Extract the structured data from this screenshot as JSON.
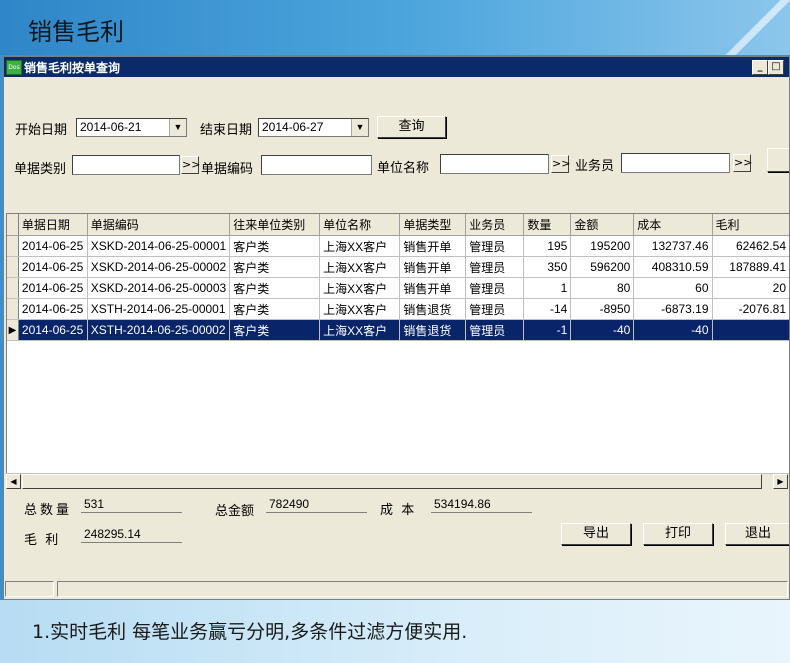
{
  "banner": {
    "title": "销售毛利"
  },
  "footer": {
    "caption": "1.实时毛利 每笔业务赢亏分明,多条件过滤方便实用."
  },
  "window": {
    "title": "销售毛利按单查询",
    "app_icon_text": "Dos",
    "controls": {
      "minimize": "_",
      "maximize": "□"
    }
  },
  "filters": {
    "start_date_label": "开始日期",
    "start_date_value": "2014-06-21",
    "end_date_label": "结束日期",
    "end_date_value": "2014-06-27",
    "query_button": "查询",
    "doc_type_label": "单据类别",
    "doc_no_label": "单据编码",
    "unit_name_label": "单位名称",
    "salesman_label": "业务员",
    "more_glyph": ">>"
  },
  "grid": {
    "columns": [
      "单据日期",
      "单据编码",
      "往来单位类别",
      "单位名称",
      "单据类型",
      "业务员",
      "数量",
      "金额",
      "成本",
      "毛利"
    ],
    "rows": [
      {
        "date": "2014-06-25",
        "code": "XSKD-2014-06-25-00001",
        "unit_type": "客户类",
        "unit_name": "上海XX客户",
        "doc_type": "销售开单",
        "salesman": "管理员",
        "qty": "195",
        "amount": "195200",
        "cost": "132737.46",
        "profit": "62462.54"
      },
      {
        "date": "2014-06-25",
        "code": "XSKD-2014-06-25-00002",
        "unit_type": "客户类",
        "unit_name": "上海XX客户",
        "doc_type": "销售开单",
        "salesman": "管理员",
        "qty": "350",
        "amount": "596200",
        "cost": "408310.59",
        "profit": "187889.41"
      },
      {
        "date": "2014-06-25",
        "code": "XSKD-2014-06-25-00003",
        "unit_type": "客户类",
        "unit_name": "上海XX客户",
        "doc_type": "销售开单",
        "salesman": "管理员",
        "qty": "1",
        "amount": "80",
        "cost": "60",
        "profit": "20"
      },
      {
        "date": "2014-06-25",
        "code": "XSTH-2014-06-25-00001",
        "unit_type": "客户类",
        "unit_name": "上海XX客户",
        "doc_type": "销售退货",
        "salesman": "管理员",
        "qty": "-14",
        "amount": "-8950",
        "cost": "-6873.19",
        "profit": "-2076.81"
      },
      {
        "date": "2014-06-25",
        "code": "XSTH-2014-06-25-00002",
        "unit_type": "客户类",
        "unit_name": "上海XX客户",
        "doc_type": "销售退货",
        "salesman": "管理员",
        "qty": "-1",
        "amount": "-40",
        "cost": "-40",
        "profit": ""
      }
    ]
  },
  "summary": {
    "total_qty_label": "总数量",
    "total_qty": "531",
    "total_amount_label": "总金额",
    "total_amount": "782490",
    "cost_label": "成  本",
    "cost": "534194.86",
    "profit_label": "毛  利",
    "profit": "248295.14"
  },
  "actions": {
    "export": "导出",
    "print": "打印",
    "exit": "退出"
  }
}
